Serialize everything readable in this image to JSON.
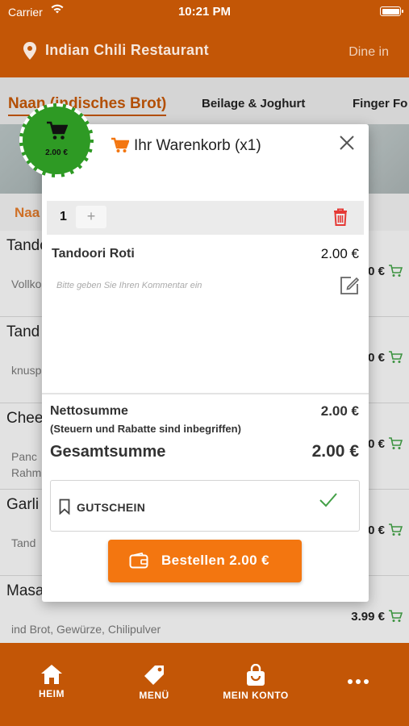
{
  "status_bar": {
    "carrier": "Carrier",
    "time": "10:21 PM"
  },
  "header": {
    "restaurant_name": "Indian Chili Restaurant",
    "mode": "Dine in"
  },
  "tabs": [
    {
      "label": "Naan (indisches Brot)",
      "active": true
    },
    {
      "label": "Beilage & Joghurt",
      "active": false
    },
    {
      "label": "Finger Fo",
      "active": false
    }
  ],
  "section_label": "Naa",
  "menu_items": [
    {
      "name": "Tando",
      "desc_line1": "Vollko",
      "desc_line2": "",
      "price": "0 €"
    },
    {
      "name": "Tand",
      "desc_line1": "knusp",
      "desc_line2": "",
      "price": "0 €"
    },
    {
      "name": "Chee",
      "desc_line1": "Panc",
      "desc_line2": "Rahm",
      "price": "0 €"
    },
    {
      "name": "Garli",
      "desc_line1": "Tand",
      "desc_line2": "",
      "price": "0 €"
    },
    {
      "name": "Masa",
      "desc_line1": "ind Brot, Gewürze, Chilipulver",
      "desc_line2": "",
      "price": "3.99 €"
    }
  ],
  "cart_badge": {
    "amount": "2.00 €"
  },
  "cart_modal": {
    "title": "Ihr Warenkorb (x1)",
    "item": {
      "quantity": "1",
      "plus_label": "+",
      "name": "Tandoori Roti",
      "price": "2.00 €",
      "comment_placeholder": "Bitte geben Sie Ihren Kommentar ein"
    },
    "net_label": "Nettosumme",
    "net_note": "(Steuern und Rabatte sind inbegriffen)",
    "net_value": "2.00 €",
    "total_label": "Gesamtsumme",
    "total_value": "2.00 €",
    "voucher_label": "GUTSCHEIN",
    "order_button": "Bestellen 2.00 €"
  },
  "bottom_nav": [
    {
      "label": "HEIM",
      "icon": "home-icon"
    },
    {
      "label": "MENÜ",
      "icon": "tag-icon"
    },
    {
      "label": "MEIN KONTO",
      "icon": "shopping-bag-icon"
    },
    {
      "label": "",
      "icon": "more-icon"
    }
  ],
  "colors": {
    "brand": "#c35606",
    "accent": "#f37610",
    "badge_green": "#2e9a24",
    "delete_red": "#e53935",
    "check_green": "#43a047"
  }
}
